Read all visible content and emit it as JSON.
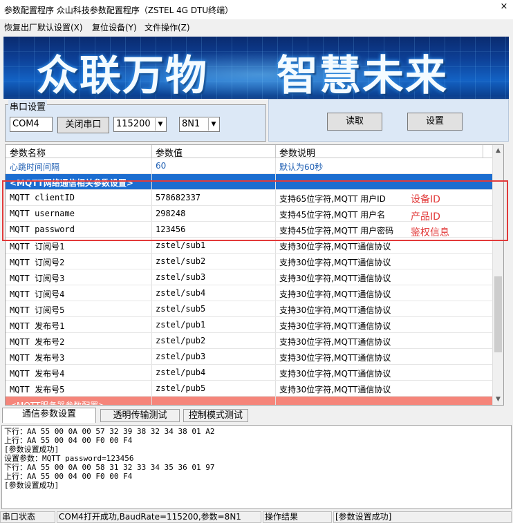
{
  "window": {
    "title": "参数配置程序  众山科技参数配置程序（ZSTEL 4G DTU终端）",
    "close_glyph": "×"
  },
  "menu": [
    "恢复出厂默认设置(X)",
    "复位设备(Y)",
    "文件操作(Z)"
  ],
  "banner": {
    "left_text": "众联万物",
    "right_text": "智慧未来"
  },
  "serial": {
    "group_label": "串口设置",
    "port": "COM4",
    "toggle_button": "关闭串口",
    "baud_rate": "115200",
    "params": "8N1"
  },
  "actions": {
    "read_button": "读取",
    "set_button": "设置"
  },
  "grid": {
    "columns": [
      "参数名称",
      "参数值",
      "参数说明"
    ],
    "rows": [
      {
        "name": "心跳时间间隔",
        "value": "60",
        "desc": "默认为60秒",
        "style": "blue"
      },
      {
        "name": "<MQTT网络通信相关参数设置>",
        "value": "",
        "desc": "",
        "style": "group"
      },
      {
        "name": "MQTT clientID",
        "value": "578682337",
        "desc": "支持65位字符,MQTT 用户ID",
        "style": "normal"
      },
      {
        "name": "MQTT username",
        "value": "298248",
        "desc": "支持45位字符,MQTT 用户名",
        "style": "normal"
      },
      {
        "name": "MQTT password",
        "value": "123456",
        "desc": "支持45位字符,MQTT 用户密码",
        "style": "normal"
      },
      {
        "name": "MQTT 订阅号1",
        "value": "zstel/sub1",
        "desc": "支持30位字符,MQTT通信协议",
        "style": "normal"
      },
      {
        "name": "MQTT 订阅号2",
        "value": "zstel/sub2",
        "desc": "支持30位字符,MQTT通信协议",
        "style": "normal"
      },
      {
        "name": "MQTT 订阅号3",
        "value": "zstel/sub3",
        "desc": "支持30位字符,MQTT通信协议",
        "style": "normal"
      },
      {
        "name": "MQTT 订阅号4",
        "value": "zstel/sub4",
        "desc": "支持30位字符,MQTT通信协议",
        "style": "normal"
      },
      {
        "name": "MQTT 订阅号5",
        "value": "zstel/sub5",
        "desc": "支持30位字符,MQTT通信协议",
        "style": "normal"
      },
      {
        "name": "MQTT 发布号1",
        "value": "zstel/pub1",
        "desc": "支持30位字符,MQTT通信协议",
        "style": "normal"
      },
      {
        "name": "MQTT 发布号2",
        "value": "zstel/pub2",
        "desc": "支持30位字符,MQTT通信协议",
        "style": "normal"
      },
      {
        "name": "MQTT 发布号3",
        "value": "zstel/pub3",
        "desc": "支持30位字符,MQTT通信协议",
        "style": "normal"
      },
      {
        "name": "MQTT 发布号4",
        "value": "zstel/pub4",
        "desc": "支持30位字符,MQTT通信协议",
        "style": "normal"
      },
      {
        "name": "MQTT 发布号5",
        "value": "zstel/pub5",
        "desc": "支持30位字符,MQTT通信协议",
        "style": "normal"
      },
      {
        "name": "<MQTT服务器参数配置>",
        "value": "",
        "desc": "",
        "style": "salmon"
      }
    ]
  },
  "annotations": [
    "设备ID",
    "产品ID",
    "鉴权信息"
  ],
  "tabs": [
    "通信参数设置",
    "透明传输测试",
    "控制模式测试"
  ],
  "log": [
    "下行：AA 55 00 0A 00 57 32 39 38 32 34 38 01 A2",
    "上行：AA 55 00 04 00 F0 00 F4",
    "[参数设置成功]",
    "设置参数：MQTT password=123456",
    "下行：AA 55 00 0A 00 58 31 32 33 34 35 36 01 97",
    "上行：AA 55 00 04 00 F0 00 F4",
    "[参数设置成功]"
  ],
  "status": {
    "label1": "串口状态",
    "value1": "COM4打开成功,BaudRate=115200,参数=8N1",
    "label2": "操作结果",
    "value2": "[参数设置成功]"
  },
  "colors": {
    "group_row": "#1c6dd0",
    "section_row": "#f5857a",
    "annotation": "#e23a3a",
    "heartbeat_text": "#1f5fb3"
  }
}
